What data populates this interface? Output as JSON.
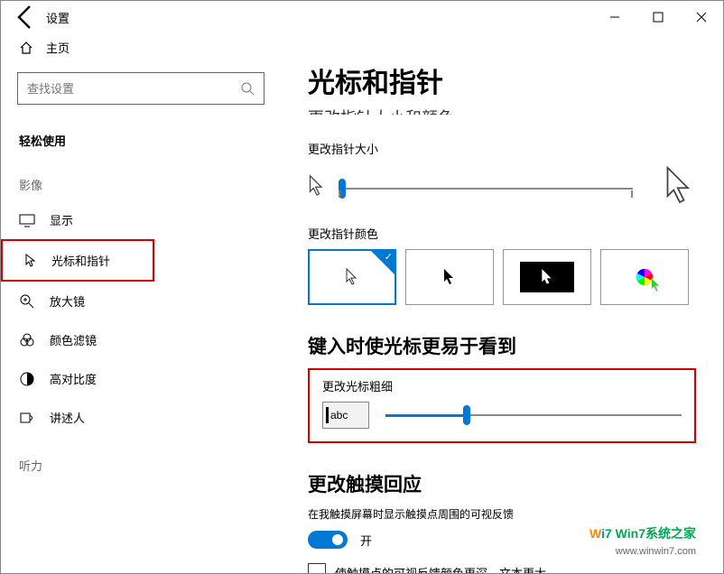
{
  "titlebar": {
    "title": "设置"
  },
  "sidebar": {
    "home": "主页",
    "search_placeholder": "查找设置",
    "group_ease": "轻松使用",
    "group_vision": "影像",
    "items": {
      "display": "显示",
      "cursor": "光标和指针",
      "magnifier": "放大镜",
      "colorfilter": "颜色滤镜",
      "highcontrast": "高对比度",
      "narrator": "讲述人"
    },
    "group_hearing": "听力"
  },
  "content": {
    "heading": "光标和指针",
    "truncated_prev": "更改指针大小和颜色",
    "pointer_size_label": "更改指针大小",
    "pointer_color_label": "更改指针颜色",
    "typing_heading": "键入时使光标更易于看到",
    "cursor_thickness_label": "更改光标粗细",
    "abc_sample": "abc",
    "touch_heading": "更改触摸回应",
    "touch_desc": "在我触摸屏幕时显示触摸点周围的可视反馈",
    "toggle_on": "开",
    "checkbox_label": "使触摸点的可视反馈颜色更深，文本更大"
  },
  "watermark": {
    "line1": "Win7系统之家",
    "line2": "www.winwin7.com"
  }
}
